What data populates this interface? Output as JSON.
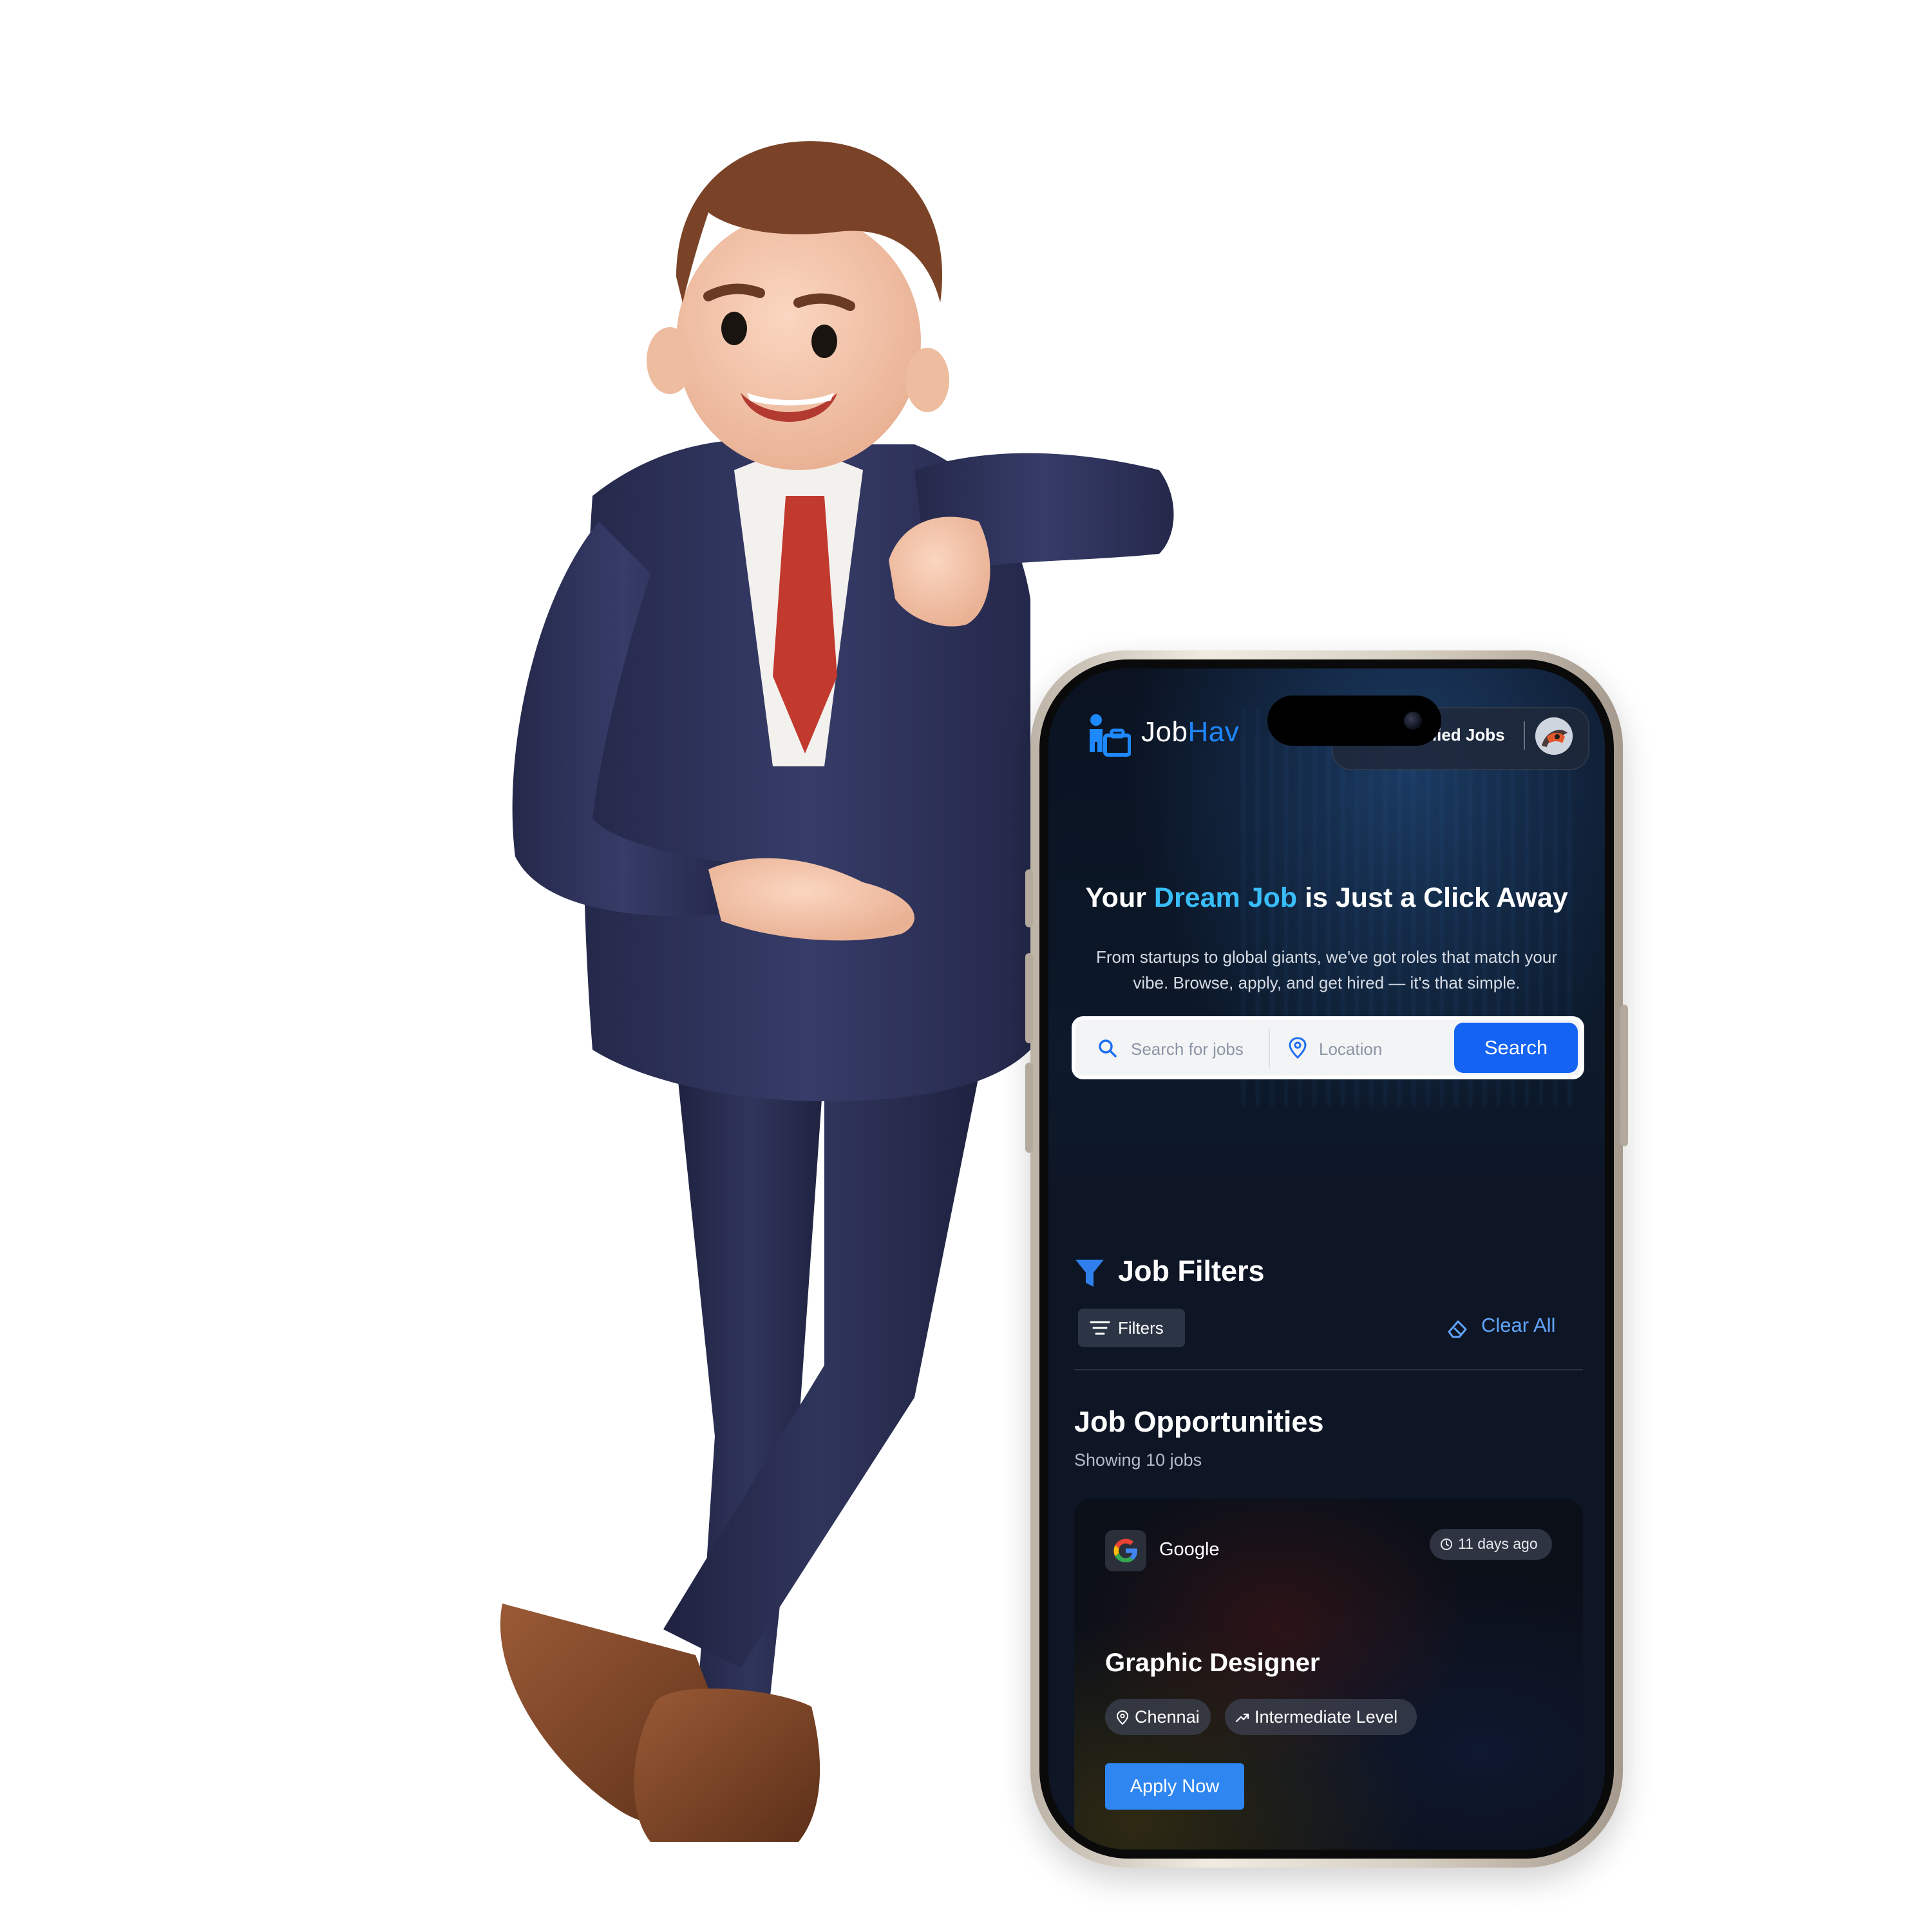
{
  "brand": {
    "name_prefix": "Job",
    "name_suffix": "Hav",
    "accent_color": "#1e88ff"
  },
  "nav": {
    "applied_jobs_label": "plied Jobs"
  },
  "hero": {
    "title_start": "Your ",
    "title_highlight": "Dream Job",
    "title_end": " is Just a Click Away",
    "highlight_color": "#38bdf8",
    "subtitle": "From startups to global giants, we've got roles that match your vibe. Browse, apply, and get hired — it's that simple."
  },
  "search": {
    "job_placeholder": "Search for jobs",
    "location_placeholder": "Location",
    "button_label": "Search",
    "button_color": "#1463f3"
  },
  "filters": {
    "title": "Job Filters",
    "filters_button_label": "Filters",
    "clear_all_label": "Clear All"
  },
  "opportunities": {
    "title": "Job Opportunities",
    "count_text": "Showing 10 jobs"
  },
  "job_cards": [
    {
      "company": "Google",
      "posted": "11 days ago",
      "title": "Graphic Designer",
      "location": "Chennai",
      "level": "Intermediate Level",
      "apply_label": "Apply Now"
    }
  ],
  "icons": {
    "logo": "person-briefcase-icon",
    "search": "search-icon",
    "location": "map-pin-icon",
    "filter": "funnel-icon",
    "filters_button": "filter-lines-icon",
    "clear": "eraser-icon",
    "clock": "clock-icon",
    "level": "trending-up-icon"
  }
}
